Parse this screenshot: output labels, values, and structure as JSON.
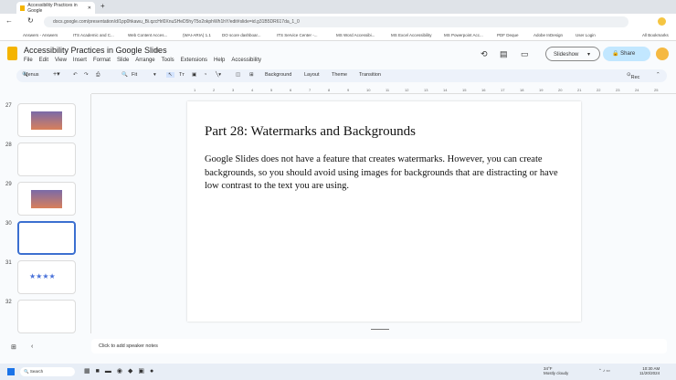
{
  "browser": {
    "tab_title": "Accessibility Practices in Google",
    "url": "docs.google.com/presentation/d/1pp0hkawu_Bi.qzcHrl0XnuSHeD5hyT5o2okphWh1hY/edit#slide=id.g31B5DR617da_1_0",
    "bookmarks": [
      "Answers - Answers",
      "ITS Academic and C...",
      "Web Content Acces...",
      "(WAI-ARIA) 1.1",
      "DO score dashboar...",
      "ITS Service Center -...",
      "MS Word Accessibi...",
      "MS Excel Accessibility",
      "MS Powerpoint Acc...",
      "PDF Deque",
      "Adobe InDesign",
      "User Login",
      "All Bookmarks"
    ]
  },
  "app": {
    "title": "Accessibility Practices in Google Slides",
    "menu": [
      "File",
      "Edit",
      "View",
      "Insert",
      "Format",
      "Slide",
      "Arrange",
      "Tools",
      "Extensions",
      "Help",
      "Accessibility"
    ],
    "slideshow": "Slideshow",
    "share": "Share"
  },
  "toolbar": {
    "search": "Menus",
    "zoom": "Fit",
    "background": "Background",
    "layout": "Layout",
    "theme": "Theme",
    "transition": "Transition",
    "rec": "Rec"
  },
  "ruler": [
    "1",
    "2",
    "3",
    "4",
    "5",
    "6",
    "7",
    "8",
    "9",
    "10",
    "11",
    "12",
    "13",
    "14",
    "15",
    "16",
    "17",
    "18",
    "19",
    "20",
    "21",
    "22",
    "23",
    "24",
    "25"
  ],
  "filmstrip": [
    {
      "num": "27"
    },
    {
      "num": "28"
    },
    {
      "num": "29"
    },
    {
      "num": "30",
      "selected": true
    },
    {
      "num": "31"
    },
    {
      "num": "32"
    }
  ],
  "slide": {
    "title": "Part 28: Watermarks and Backgrounds",
    "body": "Google Slides does not have a feature that creates watermarks. However, you can create backgrounds, so you should avoid using images for backgrounds that are distracting or have low contrast to the text you are using."
  },
  "notes": {
    "placeholder": "Click to add speaker notes"
  },
  "taskbar": {
    "search": "Search",
    "weather_temp": "34°F",
    "weather_desc": "Mostly cloudy",
    "time": "10:30 AM",
    "date": "11/20/2024"
  }
}
